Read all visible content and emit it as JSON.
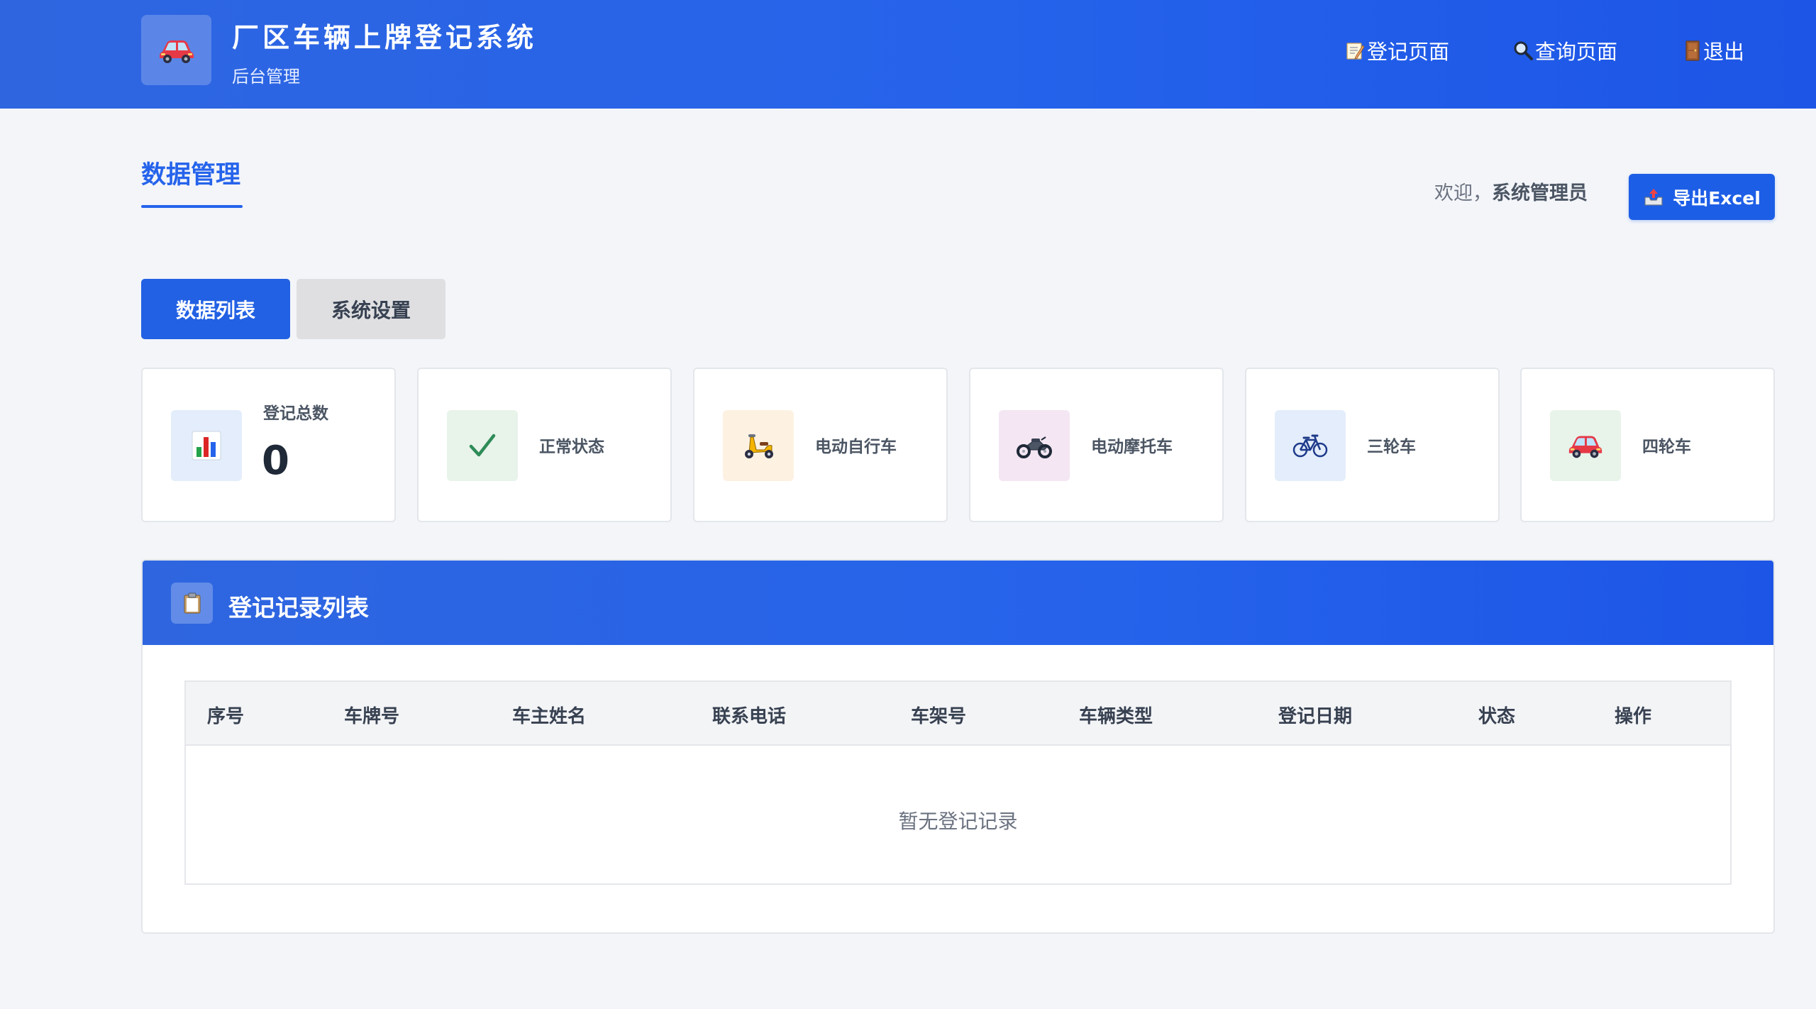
{
  "header": {
    "title": "厂区车辆上牌登记系统",
    "subtitle": "后台管理",
    "nav": [
      {
        "label": "登记页面",
        "icon": "memo-icon"
      },
      {
        "label": "查询页面",
        "icon": "magnifier-icon"
      },
      {
        "label": "退出",
        "icon": "door-icon"
      }
    ]
  },
  "page": {
    "title": "数据管理",
    "welcome_prefix": "欢迎，",
    "welcome_user": "系统管理员",
    "export_label": "导出Excel"
  },
  "tabs": [
    {
      "label": "数据列表",
      "active": true
    },
    {
      "label": "系统设置",
      "active": false
    }
  ],
  "stats": [
    {
      "label": "登记总数",
      "value": "0",
      "icon": "bar-chart-icon",
      "icon_bg": "#e3edfb"
    },
    {
      "label": "正常状态",
      "icon": "checkmark-icon",
      "icon_bg": "#e8f3ea"
    },
    {
      "label": "电动自行车",
      "icon": "scooter-icon",
      "icon_bg": "#fdf2e2"
    },
    {
      "label": "电动摩托车",
      "icon": "motorcycle-icon",
      "icon_bg": "#f4e6f3"
    },
    {
      "label": "三轮车",
      "icon": "bicycle-icon",
      "icon_bg": "#e3edfb"
    },
    {
      "label": "四轮车",
      "icon": "car-icon",
      "icon_bg": "#e8f3ea"
    }
  ],
  "records": {
    "title": "登记记录列表",
    "columns": [
      "序号",
      "车牌号",
      "车主姓名",
      "联系电话",
      "车架号",
      "车辆类型",
      "登记日期",
      "状态",
      "操作"
    ],
    "empty_text": "暂无登记记录"
  },
  "colors": {
    "primary": "#2563eb",
    "header_bg": "#2563eb",
    "page_bg": "#f3f5f9"
  }
}
